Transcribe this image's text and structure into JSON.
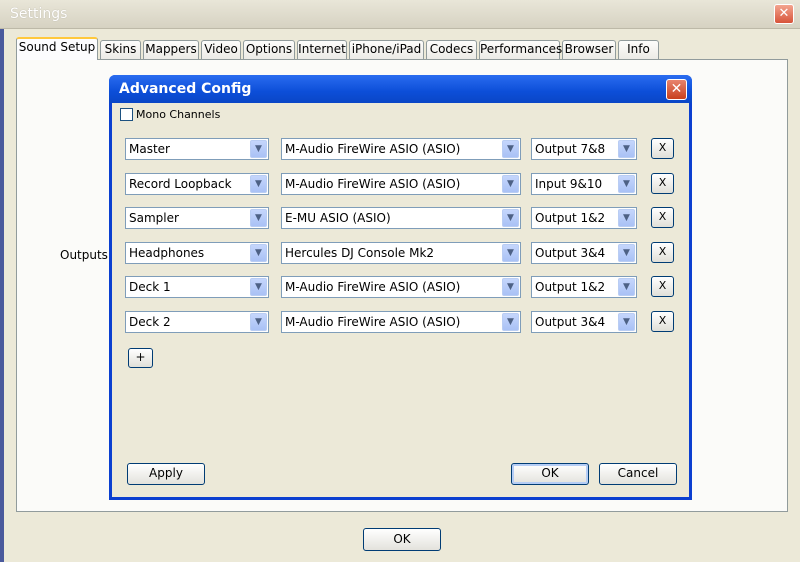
{
  "window": {
    "title": "Settings",
    "close_glyph": "✕"
  },
  "tabs": [
    {
      "label": "Sound Setup",
      "active": true
    },
    {
      "label": "Skins"
    },
    {
      "label": "Mappers"
    },
    {
      "label": "Video"
    },
    {
      "label": "Options"
    },
    {
      "label": "Internet"
    },
    {
      "label": "iPhone/iPad"
    },
    {
      "label": "Codecs"
    },
    {
      "label": "Performances"
    },
    {
      "label": "Browser"
    },
    {
      "label": "Info"
    }
  ],
  "panel": {
    "outputs_label": "Outputs :"
  },
  "footer": {
    "ok_label": "OK"
  },
  "dialog": {
    "title": "Advanced Config",
    "close_glyph": "✕",
    "mono_label": "Mono Channels",
    "mono_checked": false,
    "rows": [
      {
        "channel": "Master",
        "device": "M-Audio FireWire ASIO (ASIO)",
        "output": "Output 7&8",
        "remove": "X"
      },
      {
        "channel": "Record Loopback",
        "device": "M-Audio FireWire ASIO (ASIO)",
        "output": "Input 9&10",
        "remove": "X"
      },
      {
        "channel": "Sampler",
        "device": "E-MU ASIO (ASIO)",
        "output": "Output 1&2",
        "remove": "X"
      },
      {
        "channel": "Headphones",
        "device": "Hercules DJ Console Mk2",
        "output": "Output 3&4",
        "remove": "X"
      },
      {
        "channel": "Deck 1",
        "device": "M-Audio FireWire ASIO (ASIO)",
        "output": "Output 1&2",
        "remove": "X"
      },
      {
        "channel": "Deck 2",
        "device": "M-Audio FireWire ASIO (ASIO)",
        "output": "Output 3&4",
        "remove": "X"
      }
    ],
    "add_label": "+",
    "apply_label": "Apply",
    "ok_label": "OK",
    "cancel_label": "Cancel",
    "dropdown_glyph": "▼"
  }
}
